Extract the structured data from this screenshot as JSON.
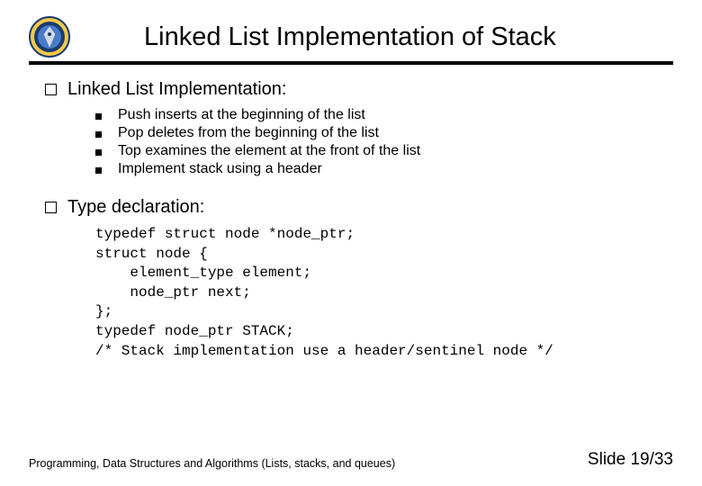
{
  "title": "Linked List Implementation of Stack",
  "section1": {
    "heading": "Linked List Implementation:",
    "items": [
      "Push inserts at the beginning of the list",
      "Pop deletes from the beginning of the list",
      "Top examines the element at the front of the list",
      "Implement stack using a header"
    ]
  },
  "section2": {
    "heading": "Type declaration:",
    "code": "typedef struct node *node_ptr;\nstruct node {\n    element_type element;\n    node_ptr next;\n};\ntypedef node_ptr STACK;\n/* Stack implementation use a header/sentinel node */"
  },
  "footer": {
    "left": "Programming, Data Structures and Algorithms  (Lists, stacks, and queues)",
    "right": "Slide 19/33"
  }
}
